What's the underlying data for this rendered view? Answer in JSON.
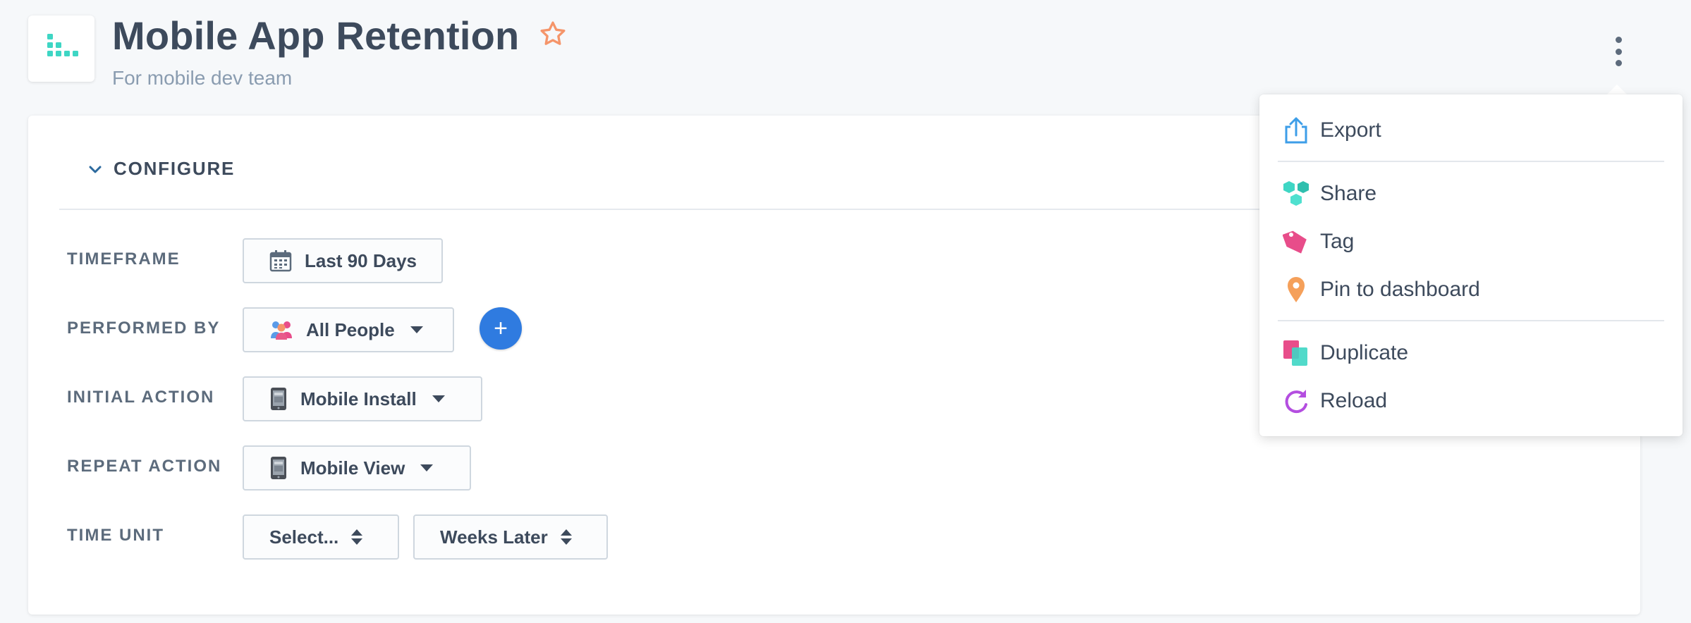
{
  "header": {
    "title": "Mobile App Retention",
    "subtitle": "For mobile dev team"
  },
  "configure": {
    "label": "CONFIGURE"
  },
  "fields": {
    "timeframe": {
      "label": "TIMEFRAME",
      "value": "Last 90 Days"
    },
    "performed_by": {
      "label": "PERFORMED BY",
      "value": "All People"
    },
    "initial_action": {
      "label": "INITIAL ACTION",
      "value": "Mobile Install"
    },
    "repeat_action": {
      "label": "REPEAT ACTION",
      "value": "Mobile View"
    },
    "time_unit": {
      "label": "TIME UNIT",
      "select_value": "Select...",
      "later_value": "Weeks Later"
    }
  },
  "add_button": {
    "symbol": "+"
  },
  "menu": {
    "items": [
      {
        "label": "Export",
        "icon": "export-icon"
      },
      {
        "label": "Share",
        "icon": "share-icon"
      },
      {
        "label": "Tag",
        "icon": "tag-icon"
      },
      {
        "label": "Pin to dashboard",
        "icon": "pin-icon"
      },
      {
        "label": "Duplicate",
        "icon": "duplicate-icon"
      },
      {
        "label": "Reload",
        "icon": "reload-icon"
      }
    ]
  },
  "colors": {
    "accent_blue": "#2f7be0",
    "logo_teal": "#3ed6c4",
    "star_orange": "#f5956a",
    "tag_pink": "#e84d8a",
    "pin_orange": "#f5a05a",
    "reload_purple": "#b44ee0"
  }
}
